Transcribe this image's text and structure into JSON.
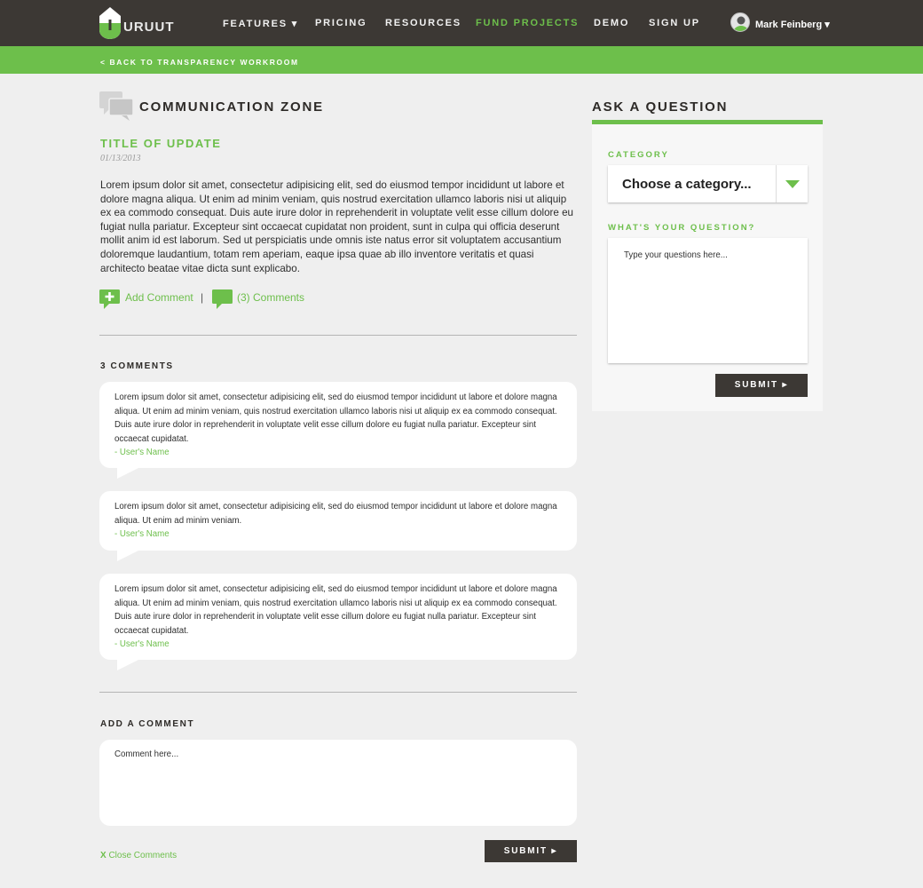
{
  "nav": {
    "logo_text": "URUUT",
    "items": [
      {
        "label": "FEATURES ▾"
      },
      {
        "label": "PRICING"
      },
      {
        "label": "RESOURCES"
      },
      {
        "label": "FUND PROJECTS"
      },
      {
        "label": "DEMO"
      },
      {
        "label": "SIGN UP"
      }
    ],
    "active_item": "FUND PROJECTS",
    "user_name": "Mark Feinberg ▾"
  },
  "breadcrumb": {
    "back_label": "< BACK TO TRANSPARENCY WORKROOM"
  },
  "communication": {
    "title": "COMMUNICATION ZONE",
    "update_title": "TITLE OF UPDATE",
    "update_date": "01/13/2013",
    "update_body": "Lorem ipsum dolor sit amet, consectetur adipisicing elit, sed do eiusmod tempor incididunt ut labore et dolore magna aliqua. Ut enim ad minim veniam, quis nostrud exercitation ullamco laboris nisi ut aliquip ex ea commodo consequat. Duis aute irure dolor in reprehenderit in voluptate velit esse cillum dolore eu fugiat nulla pariatur. Excepteur sint occaecat cupidatat non proident, sunt in culpa qui officia deserunt mollit anim id est laborum. Sed ut perspiciatis unde omnis iste natus error sit voluptatem accusantium doloremque laudantium, totam rem aperiam, eaque ipsa quae ab illo inventore veritatis et quasi architecto beatae vitae dicta sunt explicabo.",
    "add_comment_label": "Add Comment",
    "separator": "|",
    "comments_count_label": "(3) Comments"
  },
  "comments": {
    "heading": "3 COMMENTS",
    "items": [
      {
        "text": "Lorem ipsum dolor sit amet, consectetur adipisicing elit, sed do eiusmod tempor incididunt ut labore et dolore magna aliqua. Ut enim ad minim veniam, quis nostrud exercitation ullamco laboris nisi ut aliquip ex ea commodo consequat. Duis aute irure dolor in reprehenderit in voluptate velit esse cillum dolore eu fugiat nulla pariatur. Excepteur sint occaecat cupidatat.",
        "author": "- User's Name"
      },
      {
        "text": "Lorem ipsum dolor sit amet, consectetur adipisicing elit, sed do eiusmod tempor incididunt ut labore et dolore magna aliqua. Ut enim ad minim veniam.",
        "author": "- User's Name"
      },
      {
        "text": "Lorem ipsum dolor sit amet, consectetur adipisicing elit, sed do eiusmod tempor incididunt ut labore et dolore magna aliqua. Ut enim ad minim veniam, quis nostrud exercitation ullamco laboris nisi ut aliquip ex ea commodo consequat. Duis aute irure dolor in reprehenderit in voluptate velit esse cillum dolore eu fugiat nulla pariatur. Excepteur sint occaecat cupidatat.",
        "author": "- User's Name"
      }
    ]
  },
  "add_comment": {
    "heading": "ADD A COMMENT",
    "placeholder": "Comment here...",
    "close_x": "X",
    "close_label": " Close Comments",
    "submit_label": "SUBMIT ▸"
  },
  "ask": {
    "heading": "ASK A QUESTION",
    "category_label": "CATEGORY",
    "category_value": "Choose a category...",
    "question_label": "WHAT'S YOUR QUESTION?",
    "question_placeholder": "Type your questions here...",
    "submit_label": "SUBMIT ▸"
  },
  "colors": {
    "accent": "#6dbf4b",
    "dark": "#3c3834",
    "background": "#efefef"
  },
  "icons": [
    "uruut-logo-icon",
    "speech-bubbles-icon",
    "add-comment-icon",
    "comments-icon",
    "user-avatar-icon",
    "dropdown-arrow-icon"
  ]
}
